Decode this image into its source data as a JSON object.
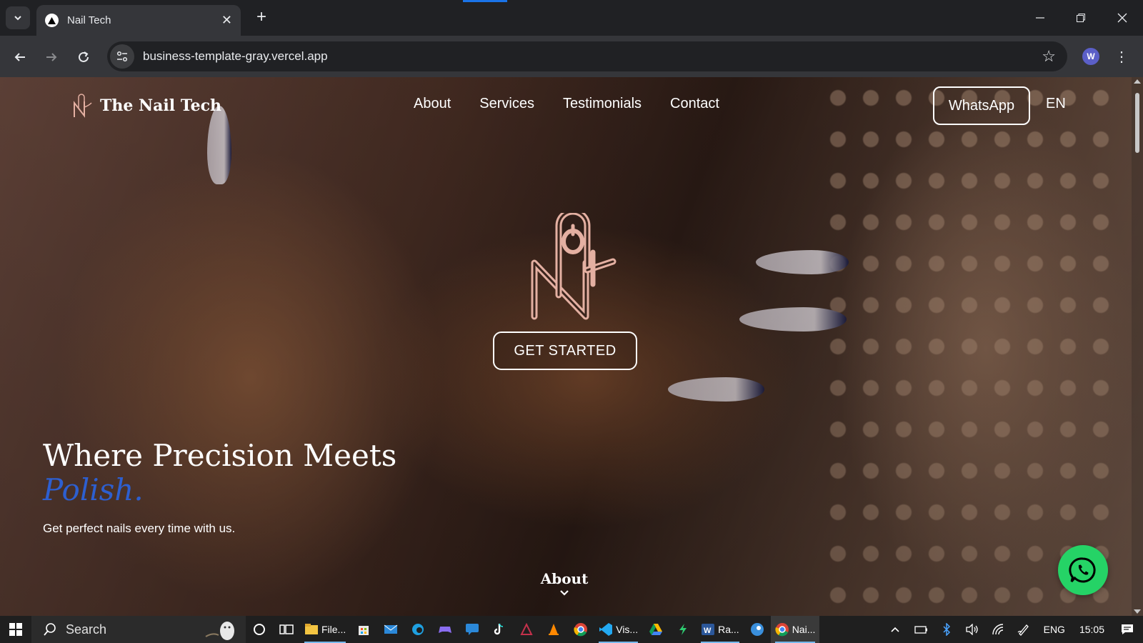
{
  "browser": {
    "tab_title": "Nail Tech",
    "url": "business-template-gray.vercel.app",
    "profile_initial": "W"
  },
  "site": {
    "brand_name": "The Nail Tech",
    "nav": [
      "About",
      "Services",
      "Testimonials",
      "Contact"
    ],
    "whatsapp_label": "WhatsApp",
    "language": "EN",
    "cta_label": "GET STARTED",
    "hero_title": "Where Precision Meets",
    "hero_accent": "Polish.",
    "hero_subtitle": "Get perfect nails every time with us.",
    "scroll_label": "About",
    "colors": {
      "accent": "#2d5fd0",
      "logo": "#e4b0a2",
      "whatsapp": "#25d366"
    }
  },
  "taskbar": {
    "search_placeholder": "Search",
    "apps": [
      {
        "icon": "file-explorer-icon",
        "label": "File..."
      },
      {
        "icon": "vscode-icon",
        "label": "Vis..."
      },
      {
        "icon": "word-icon",
        "label": "Ra..."
      },
      {
        "icon": "chrome-icon",
        "label": "Nai..."
      }
    ],
    "language": "ENG",
    "time": "15:05"
  }
}
